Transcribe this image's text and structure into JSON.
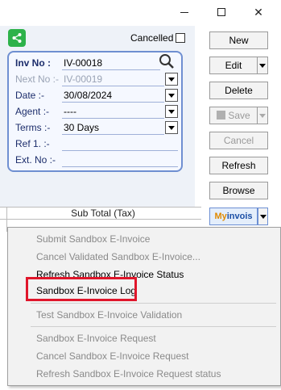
{
  "window": {
    "minimize_icon": "minimize-icon",
    "maximize_icon": "maximize-icon",
    "close_icon": "close-icon",
    "close_glyph": "✕"
  },
  "header": {
    "share_icon": "share-icon",
    "cancelled_label": "Cancelled",
    "cancelled_checked": false
  },
  "invoice": {
    "inv_no_label": "Inv No :",
    "inv_no_value": "IV-00018",
    "next_no_label": "Next No :-",
    "next_no_value": "IV-00019",
    "date_label": "Date :-",
    "date_value": "30/08/2024",
    "agent_label": "Agent :-",
    "agent_value": "----",
    "terms_label": "Terms :-",
    "terms_value": "30 Days",
    "ref_label": "Ref 1. :-",
    "ref_value": "",
    "ext_no_label": "Ext. No :-",
    "ext_no_value": ""
  },
  "toolbar": {
    "new_label": "New",
    "edit_label": "Edit",
    "delete_label": "Delete",
    "save_label": "Save",
    "cancel_label": "Cancel",
    "refresh_label": "Refresh",
    "browse_label": "Browse",
    "myinvois_my": "My",
    "myinvois_invois": "invois"
  },
  "grid": {
    "column_subtotal_tax": "Sub Total (Tax)"
  },
  "menu": {
    "items": [
      {
        "label": "Submit Sandbox E-Invoice",
        "enabled": false
      },
      {
        "label": "Cancel Validated Sandbox E-Invoice...",
        "enabled": false
      },
      {
        "label": "Refresh Sandbox E-Invoice Status",
        "enabled": true
      },
      {
        "label": "Sandbox E-Invoice Log",
        "enabled": true,
        "highlighted": true
      },
      {
        "label": "Test Sandbox E-Invoice Validation",
        "enabled": false
      },
      {
        "label": "Sandbox E-Invoice Request",
        "enabled": false
      },
      {
        "label": "Cancel Sandbox E-Invoice Request",
        "enabled": false
      },
      {
        "label": "Refresh Sandbox E-Invoice Request status",
        "enabled": false
      }
    ]
  },
  "colors": {
    "panel_border": "#6f8fd1",
    "highlight_box": "#e0162b",
    "share_green": "#2db24a"
  }
}
